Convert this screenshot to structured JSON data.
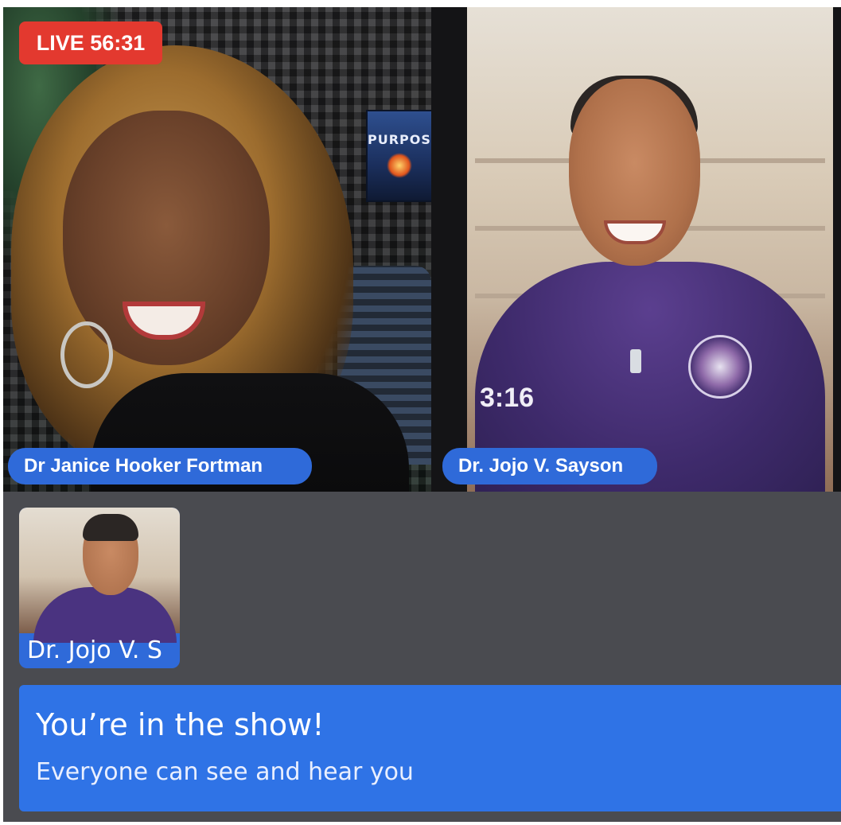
{
  "live_badge": {
    "label": "LIVE 56:31"
  },
  "participants": [
    {
      "name": "Dr Janice Hooker Fortman"
    },
    {
      "name": "Dr. Jojo V. Sayson"
    }
  ],
  "host_scene": {
    "book_title": "PURPOSE"
  },
  "guest_scene": {
    "shirt_text": "3:16"
  },
  "self_view": {
    "label": "Dr. Jojo V. S"
  },
  "banner": {
    "title": "You’re in the show!",
    "subtitle": "Everyone can see and hear you"
  },
  "colors": {
    "live_red": "#e3392f",
    "name_pill_blue": "#2f6ad9",
    "banner_blue": "#2f73e6",
    "stage_gray": "#4a4b50"
  }
}
